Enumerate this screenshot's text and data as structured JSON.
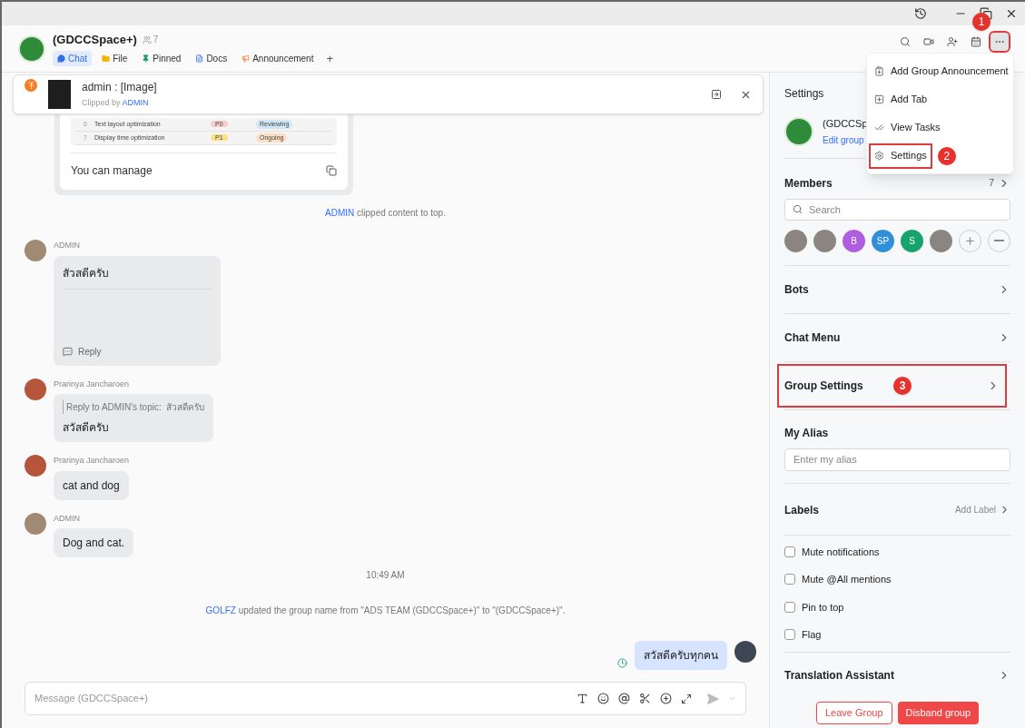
{
  "header": {
    "title": "(GDCCSpace+)",
    "member_count": "7",
    "tabs": [
      {
        "label": "Chat",
        "selected": true
      },
      {
        "label": "File",
        "selected": false
      },
      {
        "label": "Pinned",
        "selected": false
      },
      {
        "label": "Docs",
        "selected": false
      },
      {
        "label": "Announcement",
        "selected": false
      }
    ],
    "add_tab": "+",
    "toolbar": [
      {
        "highlighted": false
      },
      {
        "highlighted": false
      },
      {
        "highlighted": false
      },
      {
        "highlighted": false
      },
      {
        "highlighted": true,
        "badge": "1"
      }
    ]
  },
  "pinned_banner": {
    "title": "admin : [Image]",
    "clipped_by": "Clipped by",
    "actor": "ADMIN"
  },
  "messages": [
    {
      "kind": "clip_card",
      "rows": [
        {
          "no": "6",
          "task": "Text layout optimization",
          "priority": {
            "text": "P0",
            "color": "#f7cdcd"
          },
          "status": {
            "text": "Reviewing",
            "color": "#cfe7f6"
          }
        },
        {
          "no": "7",
          "task": "Display time optimization",
          "priority": {
            "text": "P1",
            "color": "#fbe38a"
          },
          "status": {
            "text": "Ongoing",
            "color": "#fbdfc2"
          }
        }
      ],
      "text": "You can manage"
    },
    {
      "kind": "system",
      "actor": "ADMIN",
      "text": "clipped content to top."
    },
    {
      "kind": "topic",
      "sender": "ADMIN",
      "text": "สัวสดีครับ",
      "action": "Reply"
    },
    {
      "kind": "reply",
      "sender": "Prarinya Jancharoen",
      "quote_label": "Reply to ADMIN's topic:",
      "quote": "สัวสดีครับ",
      "text": "สวัสดีครับ"
    },
    {
      "kind": "text",
      "sender": "Prarinya Jancharoen",
      "text": "cat and dog"
    },
    {
      "kind": "text",
      "sender": "ADMIN",
      "text": "Dog and cat."
    },
    {
      "kind": "time",
      "text": "10:49 AM"
    },
    {
      "kind": "system",
      "actor": "GOLFZ",
      "text": "updated the group name from \"ADS TEAM (GDCCSpace+)\" to \"(GDCCSpace+)\"."
    },
    {
      "kind": "own",
      "text": "สวัสดีครับทุกคน"
    }
  ],
  "composer": {
    "placeholder": "Message (GDCCSpace+)"
  },
  "menu": [
    {
      "label": "Add Group Announcement",
      "highlighted": false
    },
    {
      "label": "Add Tab",
      "highlighted": false
    },
    {
      "label": "View Tasks",
      "highlighted": false
    },
    {
      "label": "Settings",
      "highlighted": true,
      "badge": "2"
    }
  ],
  "settings": {
    "title": "Settings",
    "group_name": "(GDCCSp",
    "edit_link": "Edit group",
    "members": {
      "title": "Members",
      "count": "7",
      "search_placeholder": "Search",
      "avatars": [
        {
          "kind": "photo"
        },
        {
          "kind": "photo"
        },
        {
          "kind": "letter",
          "text": "B",
          "color": "#b05ee0"
        },
        {
          "kind": "letter",
          "text": "SP",
          "color": "#2f8fd9"
        },
        {
          "kind": "letter",
          "text": "S",
          "color": "#17a36c"
        },
        {
          "kind": "photo"
        }
      ]
    },
    "nav_rows": [
      {
        "label": "Bots",
        "highlighted": false
      },
      {
        "label": "Chat Menu",
        "highlighted": false
      },
      {
        "label": "Group Settings",
        "highlighted": true,
        "badge": "3"
      }
    ],
    "alias": {
      "title": "My Alias",
      "placeholder": "Enter my alias"
    },
    "labels": {
      "title": "Labels",
      "action": "Add Label"
    },
    "options": [
      {
        "label": "Mute notifications",
        "checked": false
      },
      {
        "label": "Mute @All mentions",
        "checked": false
      },
      {
        "label": "Pin to top",
        "checked": false
      },
      {
        "label": "Flag",
        "checked": false
      }
    ],
    "translation": "Translation Assistant",
    "buttons": [
      {
        "label": "Leave Group",
        "kind": "outline"
      },
      {
        "label": "Disband group",
        "kind": "solid"
      }
    ]
  }
}
